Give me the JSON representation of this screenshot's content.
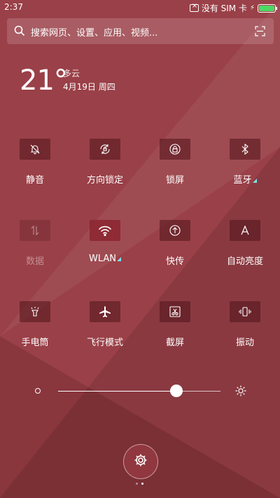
{
  "status_bar": {
    "time": "2:37",
    "carrier": "没有 SIM 卡"
  },
  "search": {
    "placeholder": "搜索网页、设置、应用、视频..."
  },
  "weather": {
    "temperature": "21°",
    "condition": "多云",
    "date": "4月19日 周四"
  },
  "toggles": [
    {
      "label": "静音",
      "icon": "mute-bell-icon",
      "state": "off"
    },
    {
      "label": "方向锁定",
      "icon": "rotation-lock-icon",
      "state": "off"
    },
    {
      "label": "锁屏",
      "icon": "lock-icon",
      "state": "off"
    },
    {
      "label": "蓝牙",
      "icon": "bluetooth-icon",
      "state": "off"
    },
    {
      "label": "数据",
      "icon": "data-arrows-icon",
      "state": "disabled"
    },
    {
      "label": "WLAN",
      "icon": "wifi-icon",
      "state": "on"
    },
    {
      "label": "快传",
      "icon": "quick-transfer-icon",
      "state": "off"
    },
    {
      "label": "自动亮度",
      "icon": "auto-brightness-icon",
      "state": "off"
    },
    {
      "label": "手电筒",
      "icon": "flashlight-icon",
      "state": "off"
    },
    {
      "label": "飞行模式",
      "icon": "airplane-icon",
      "state": "off"
    },
    {
      "label": "截屏",
      "icon": "screenshot-icon",
      "state": "off"
    },
    {
      "label": "振动",
      "icon": "vibrate-icon",
      "state": "off"
    }
  ],
  "brightness": {
    "level": 0.73
  },
  "pager": {
    "pages": 2,
    "current": 2
  },
  "colors": {
    "background": "#9a4048",
    "battery": "#4cd964",
    "accent_corner": "#7ee0f0"
  }
}
